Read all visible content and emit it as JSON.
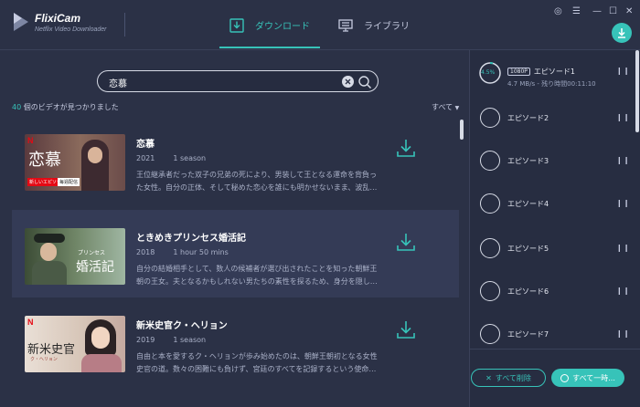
{
  "app": {
    "name": "FlixiCam",
    "subtitle": "Netflix Video Downloader"
  },
  "tabs": [
    {
      "label": "ダウンロード",
      "active": true
    },
    {
      "label": "ライブラリ",
      "active": false
    }
  ],
  "window_controls": [
    "◎",
    "☰",
    "—",
    "☐",
    "✕"
  ],
  "search": {
    "value": "恋慕"
  },
  "results": {
    "count": "40",
    "text": " 個のビデオが見つかりました",
    "filter": "すべて"
  },
  "items": [
    {
      "title": "恋慕",
      "year": "2021",
      "season": "1 season",
      "desc": "王位継承者だった双子の兄弟の死により、男装して王となる運命を背負った女性。自分の正体、そして秘めた恋心を誰にも明かせないまま、波乱…",
      "thumb_text": "恋慕",
      "thumb_badge1": "新しいエピソード",
      "thumb_badge2": "毎週配信"
    },
    {
      "title": "ときめきプリンセス婚活記",
      "year": "2018",
      "season": "1 hour 50 mins",
      "desc": "自分の結婚相手として、数人の候補者が選び出されたことを知った朝鮮王朝の王女。夫となるかもしれない男たちの素性を探るため、身分を隠し…",
      "thumb_text": "婚活記",
      "thumb_small": "プリンセス"
    },
    {
      "title": "新米史官ク・ヘリョン",
      "year": "2019",
      "season": "1 season",
      "desc": "自由と本を愛するク・ヘリョンが歩み始めたのは、朝鮮王朝初となる女性史官の道。数々の困難にも負けず、宮廷のすべてを記録するという使命…",
      "thumb_text": "新米史官",
      "thumb_small": "ク・ヘリョン"
    }
  ],
  "episodes": [
    {
      "label": "エピソード1",
      "quality": "1080P",
      "progress": "4.5%",
      "status": "4.7 MB/s - 残り時間00:11:10"
    },
    {
      "label": "エピソード2"
    },
    {
      "label": "エピソード3"
    },
    {
      "label": "エピソード4"
    },
    {
      "label": "エピソード5"
    },
    {
      "label": "エピソード6"
    },
    {
      "label": "エピソード7"
    }
  ],
  "buttons": {
    "delete_all": "すべて削除",
    "pause_all": "すべて一時..."
  },
  "colors": {
    "accent": "#37c3b9",
    "background": "#2b3146",
    "panel": "#272d41",
    "netflix_red": "#e50914"
  }
}
